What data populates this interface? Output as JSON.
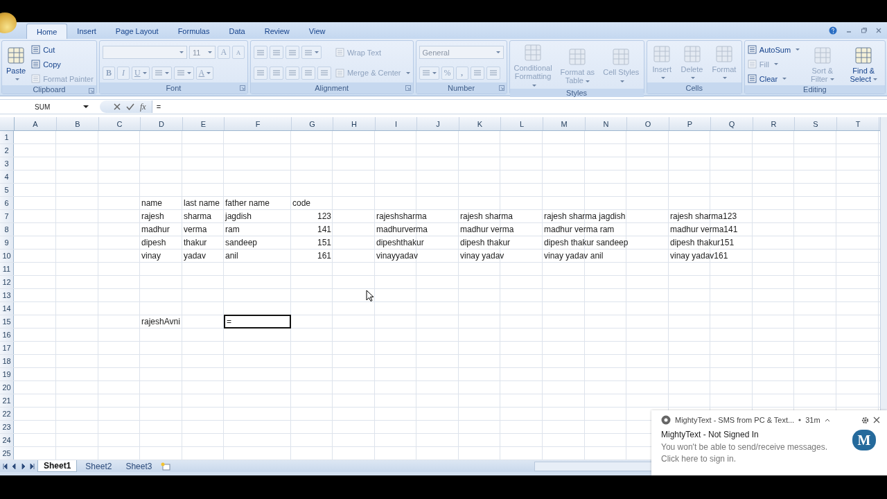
{
  "ribbon_tabs": [
    {
      "label": "Home",
      "selected": true
    },
    {
      "label": "Insert",
      "selected": false
    },
    {
      "label": "Page Layout",
      "selected": false
    },
    {
      "label": "Formulas",
      "selected": false
    },
    {
      "label": "Data",
      "selected": false
    },
    {
      "label": "Review",
      "selected": false
    },
    {
      "label": "View",
      "selected": false
    }
  ],
  "ribbon_groups": [
    {
      "label": "Clipboard",
      "launcher": true,
      "columns": [
        [
          [
            {
              "kind": "large",
              "label": "Paste",
              "disabled": false,
              "caret": true
            }
          ]
        ],
        [
          [
            {
              "kind": "small",
              "label": "Cut",
              "disabled": false,
              "caret": false
            }
          ],
          [
            {
              "kind": "small",
              "label": "Copy",
              "disabled": false,
              "caret": false
            }
          ],
          [
            {
              "kind": "small",
              "label": "Format Painter",
              "disabled": true,
              "caret": false
            }
          ]
        ]
      ]
    },
    {
      "label": "Font",
      "launcher": true,
      "columns": [
        [
          [
            {
              "kind": "combo-wide",
              "disabled": true
            },
            {
              "kind": "combo-narrow",
              "value": "11",
              "disabled": true
            },
            {
              "kind": "glyph",
              "label": "A",
              "disabled": true,
              "caret": false
            },
            {
              "kind": "small-glyph",
              "label": "A",
              "disabled": true,
              "caret": false
            }
          ],
          [
            {
              "kind": "bold-glyph",
              "label": "B",
              "disabled": true,
              "caret": false
            },
            {
              "kind": "italic-glyph",
              "label": "I",
              "disabled": true,
              "caret": false
            },
            {
              "kind": "underline-glyph",
              "label": "U",
              "disabled": true,
              "caret": true
            },
            {
              "kind": "icon",
              "disabled": true,
              "caret": true
            },
            {
              "kind": "icon",
              "disabled": true,
              "caret": true
            },
            {
              "kind": "underline-glyph",
              "label": "A",
              "disabled": true,
              "caret": true
            }
          ]
        ]
      ]
    },
    {
      "label": "Alignment",
      "launcher": true,
      "columns": [
        [
          [
            {
              "kind": "icon",
              "disabled": true,
              "caret": false
            },
            {
              "kind": "icon",
              "disabled": true,
              "caret": false
            },
            {
              "kind": "icon",
              "disabled": true,
              "caret": false
            },
            {
              "kind": "icon",
              "disabled": true,
              "caret": true
            }
          ],
          [
            {
              "kind": "icon",
              "disabled": true,
              "caret": false
            },
            {
              "kind": "icon",
              "disabled": true,
              "caret": false
            },
            {
              "kind": "icon",
              "disabled": true,
              "caret": false
            },
            {
              "kind": "icon",
              "disabled": true,
              "caret": false
            },
            {
              "kind": "icon",
              "disabled": true,
              "caret": false
            }
          ]
        ],
        [
          [
            {
              "kind": "small",
              "label": "Wrap Text",
              "disabled": true,
              "caret": false
            }
          ],
          [
            {
              "kind": "small",
              "label": "Merge & Center",
              "disabled": true,
              "caret": true
            }
          ]
        ]
      ]
    },
    {
      "label": "Number",
      "launcher": true,
      "columns": [
        [
          [
            {
              "kind": "combo-wide",
              "value": "General",
              "disabled": true
            }
          ],
          [
            {
              "kind": "icon",
              "disabled": true,
              "caret": true
            },
            {
              "kind": "glyph",
              "label": "%",
              "disabled": true,
              "caret": false
            },
            {
              "kind": "bold-glyph",
              "label": ",",
              "disabled": true,
              "caret": false
            },
            {
              "kind": "icon",
              "disabled": true,
              "caret": false
            },
            {
              "kind": "icon",
              "disabled": true,
              "caret": false
            }
          ]
        ]
      ]
    },
    {
      "label": "Styles",
      "launcher": false,
      "columns": [
        [
          [
            {
              "kind": "large",
              "label": "Conditional Formatting",
              "disabled": true,
              "caret": true
            }
          ]
        ],
        [
          [
            {
              "kind": "large",
              "label": "Format as Table",
              "disabled": true,
              "caret": true
            }
          ]
        ],
        [
          [
            {
              "kind": "large",
              "label": "Cell Styles",
              "disabled": true,
              "caret": true
            }
          ]
        ]
      ]
    },
    {
      "label": "Cells",
      "launcher": false,
      "columns": [
        [
          [
            {
              "kind": "large",
              "label": "Insert",
              "disabled": true,
              "caret": true
            }
          ]
        ],
        [
          [
            {
              "kind": "large",
              "label": "Delete",
              "disabled": true,
              "caret": true
            }
          ]
        ],
        [
          [
            {
              "kind": "large",
              "label": "Format",
              "disabled": true,
              "caret": true
            }
          ]
        ]
      ]
    },
    {
      "label": "Editing",
      "launcher": false,
      "columns": [
        [
          [
            {
              "kind": "small",
              "label": "AutoSum",
              "disabled": false,
              "caret": true
            }
          ],
          [
            {
              "kind": "small",
              "label": "Fill",
              "disabled": true,
              "caret": true
            }
          ],
          [
            {
              "kind": "small",
              "label": "Clear",
              "disabled": false,
              "caret": true
            }
          ]
        ],
        [
          [
            {
              "kind": "large",
              "label": "Sort & Filter",
              "disabled": true,
              "caret": true
            }
          ]
        ],
        [
          [
            {
              "kind": "large",
              "label": "Find & Select",
              "disabled": false,
              "caret": true
            }
          ]
        ]
      ]
    }
  ],
  "formula_bar": {
    "name_box": "SUM",
    "function_button": "fx",
    "formula": "="
  },
  "columns": [
    "A",
    "B",
    "C",
    "D",
    "E",
    "F",
    "G",
    "H",
    "I",
    "J",
    "K",
    "L",
    "M",
    "N",
    "O",
    "P",
    "Q",
    "R",
    "S",
    "T"
  ],
  "rows": [
    {
      "number": "1"
    },
    {
      "number": "2"
    },
    {
      "number": "3"
    },
    {
      "number": "4"
    },
    {
      "number": "5"
    },
    {
      "number": "6",
      "cells": {
        "D": {
          "kind": "text",
          "text": "name",
          "active": false
        },
        "E": {
          "kind": "text",
          "text": "last name",
          "active": false
        },
        "F": {
          "kind": "text",
          "text": "father name",
          "active": false
        },
        "G": {
          "kind": "text",
          "text": "code",
          "active": false
        }
      }
    },
    {
      "number": "7",
      "cells": {
        "D": {
          "kind": "text",
          "text": "rajesh",
          "active": false
        },
        "E": {
          "kind": "text",
          "text": "sharma",
          "active": false
        },
        "F": {
          "kind": "text",
          "text": "jagdish",
          "active": false
        },
        "G": {
          "kind": "number",
          "text": "123",
          "active": false
        },
        "I": {
          "kind": "text",
          "text": "rajeshsharma",
          "active": false
        },
        "K": {
          "kind": "text",
          "text": "rajesh sharma",
          "active": false
        },
        "M": {
          "kind": "text",
          "text": "rajesh sharma jagdish",
          "active": false
        },
        "P": {
          "kind": "text",
          "text": "rajesh sharma123",
          "active": false
        }
      }
    },
    {
      "number": "8",
      "cells": {
        "D": {
          "kind": "text",
          "text": "madhur",
          "active": false
        },
        "E": {
          "kind": "text",
          "text": "verma",
          "active": false
        },
        "F": {
          "kind": "text",
          "text": "ram",
          "active": false
        },
        "G": {
          "kind": "number",
          "text": "141",
          "active": false
        },
        "I": {
          "kind": "text",
          "text": "madhurverma",
          "active": false
        },
        "K": {
          "kind": "text",
          "text": "madhur verma",
          "active": false
        },
        "M": {
          "kind": "text",
          "text": "madhur verma ram",
          "active": false
        },
        "P": {
          "kind": "text",
          "text": "madhur verma141",
          "active": false
        }
      }
    },
    {
      "number": "9",
      "cells": {
        "D": {
          "kind": "text",
          "text": "dipesh",
          "active": false
        },
        "E": {
          "kind": "text",
          "text": "thakur",
          "active": false
        },
        "F": {
          "kind": "text",
          "text": "sandeep",
          "active": false
        },
        "G": {
          "kind": "number",
          "text": "151",
          "active": false
        },
        "I": {
          "kind": "text",
          "text": "dipeshthakur",
          "active": false
        },
        "K": {
          "kind": "text",
          "text": "dipesh thakur",
          "active": false
        },
        "M": {
          "kind": "text",
          "text": "dipesh thakur sandeep",
          "active": false
        },
        "P": {
          "kind": "text",
          "text": "dipesh thakur151",
          "active": false
        }
      }
    },
    {
      "number": "10",
      "cells": {
        "D": {
          "kind": "text",
          "text": "vinay",
          "active": false
        },
        "E": {
          "kind": "text",
          "text": "yadav",
          "active": false
        },
        "F": {
          "kind": "text",
          "text": "anil",
          "active": false
        },
        "G": {
          "kind": "number",
          "text": "161",
          "active": false
        },
        "I": {
          "kind": "text",
          "text": "vinayyadav",
          "active": false
        },
        "K": {
          "kind": "text",
          "text": "vinay yadav",
          "active": false
        },
        "M": {
          "kind": "text",
          "text": "vinay yadav anil",
          "active": false
        },
        "P": {
          "kind": "text",
          "text": "vinay yadav161",
          "active": false
        }
      }
    },
    {
      "number": "11"
    },
    {
      "number": "12"
    },
    {
      "number": "13"
    },
    {
      "number": "14"
    },
    {
      "number": "15",
      "cells": {
        "D": {
          "kind": "text",
          "text": "rajeshAvni",
          "active": false
        },
        "F": {
          "kind": "text",
          "text": "=",
          "active": true
        }
      }
    },
    {
      "number": "16"
    },
    {
      "number": "17"
    },
    {
      "number": "18"
    },
    {
      "number": "19"
    },
    {
      "number": "20"
    },
    {
      "number": "21"
    },
    {
      "number": "22"
    },
    {
      "number": "23"
    },
    {
      "number": "24"
    },
    {
      "number": "25"
    }
  ],
  "sheet_tabs": [
    {
      "label": "Sheet1",
      "selected": true
    },
    {
      "label": "Sheet2",
      "selected": false
    },
    {
      "label": "Sheet3",
      "selected": false
    }
  ],
  "notification": {
    "source": "MightyText - SMS from PC & Text...",
    "time": "31m",
    "logo_letter": "M",
    "title": "MightyText - Not Signed In",
    "message": "You won't be able to send/receive messages.",
    "link": "Click here to sign in."
  }
}
